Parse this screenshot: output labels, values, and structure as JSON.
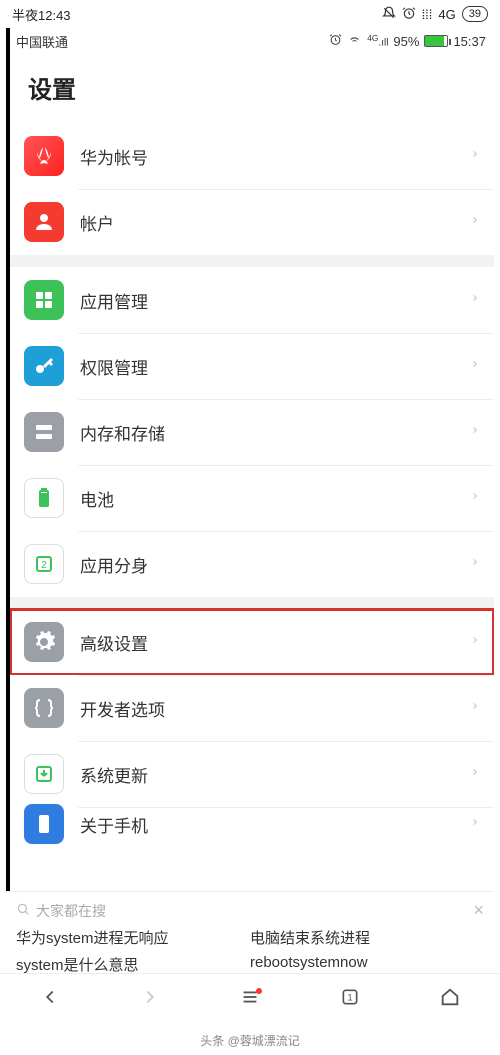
{
  "outer_status": {
    "time": "半夜12:43",
    "signal": "4G",
    "battery": "39"
  },
  "inner_status": {
    "carrier": "中国联通",
    "battery_pct": "95%",
    "time": "15:37"
  },
  "page": {
    "title": "设置"
  },
  "sections": [
    {
      "items": [
        {
          "key": "huawei",
          "label": "华为帐号",
          "icon": "huawei-icon",
          "bg": "ic-huawei"
        },
        {
          "key": "account",
          "label": "帐户",
          "icon": "account-icon",
          "bg": "ic-account"
        }
      ]
    },
    {
      "items": [
        {
          "key": "apps",
          "label": "应用管理",
          "icon": "apps-icon",
          "bg": "ic-apps"
        },
        {
          "key": "perm",
          "label": "权限管理",
          "icon": "key-icon",
          "bg": "ic-perm"
        },
        {
          "key": "storage",
          "label": "内存和存储",
          "icon": "storage-icon",
          "bg": "ic-storage"
        },
        {
          "key": "battery",
          "label": "电池",
          "icon": "battery-icon",
          "bg": "ic-battery"
        },
        {
          "key": "clone",
          "label": "应用分身",
          "icon": "clone-icon",
          "bg": "ic-clone"
        }
      ]
    },
    {
      "items": [
        {
          "key": "advanced",
          "label": "高级设置",
          "icon": "gear-icon",
          "bg": "ic-advanced",
          "highlighted": true
        },
        {
          "key": "dev",
          "label": "开发者选项",
          "icon": "braces-icon",
          "bg": "ic-dev"
        },
        {
          "key": "update",
          "label": "系统更新",
          "icon": "update-icon",
          "bg": "ic-update"
        },
        {
          "key": "about",
          "label": "关于手机",
          "icon": "about-icon",
          "bg": "ic-about",
          "cut": true
        }
      ]
    }
  ],
  "suggest": {
    "header": "大家都在搜",
    "items": [
      "华为system进程无响应",
      "电脑结束系统进程",
      "system是什么意思",
      "rebootsystemnow"
    ]
  },
  "footer": {
    "text": "头条 @蓉城漂流记"
  }
}
